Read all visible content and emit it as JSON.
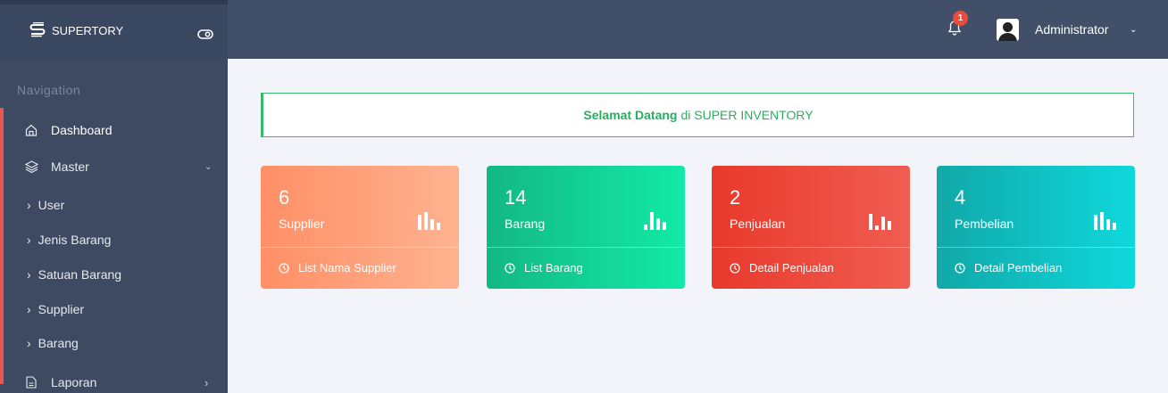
{
  "header": {
    "brand": "SUPERTORY",
    "notification_count": "1",
    "user_name": "Administrator",
    "icons": [
      "logo-icon",
      "toggle-icon",
      "bell-icon",
      "avatar-icon",
      "chevron-down-icon"
    ]
  },
  "sidebar": {
    "title": "Navigation",
    "items": [
      {
        "label": "Dashboard",
        "icon": "home-icon"
      },
      {
        "label": "Master",
        "icon": "layers-icon"
      },
      {
        "label": "User"
      },
      {
        "label": "Jenis Barang"
      },
      {
        "label": "Satuan Barang"
      },
      {
        "label": "Supplier"
      },
      {
        "label": "Barang"
      },
      {
        "label": "Laporan",
        "icon": "file-icon"
      }
    ],
    "accent_color": "#e8574f"
  },
  "welcome": {
    "bold": "Selamat Datang",
    "rest": "di SUPER INVENTORY",
    "color": "#27ae60"
  },
  "cards": [
    {
      "count": "6",
      "label": "Supplier",
      "link": "List Nama Supplier",
      "color": "#ff9a70"
    },
    {
      "count": "14",
      "label": "Barang",
      "link": "List Barang",
      "color": "#13c98f"
    },
    {
      "count": "2",
      "label": "Penjualan",
      "link": "Detail Penjualan",
      "color": "#ea4436"
    },
    {
      "count": "4",
      "label": "Pembelian",
      "link": "Detail Pembelian",
      "color": "#10bfc2"
    }
  ]
}
